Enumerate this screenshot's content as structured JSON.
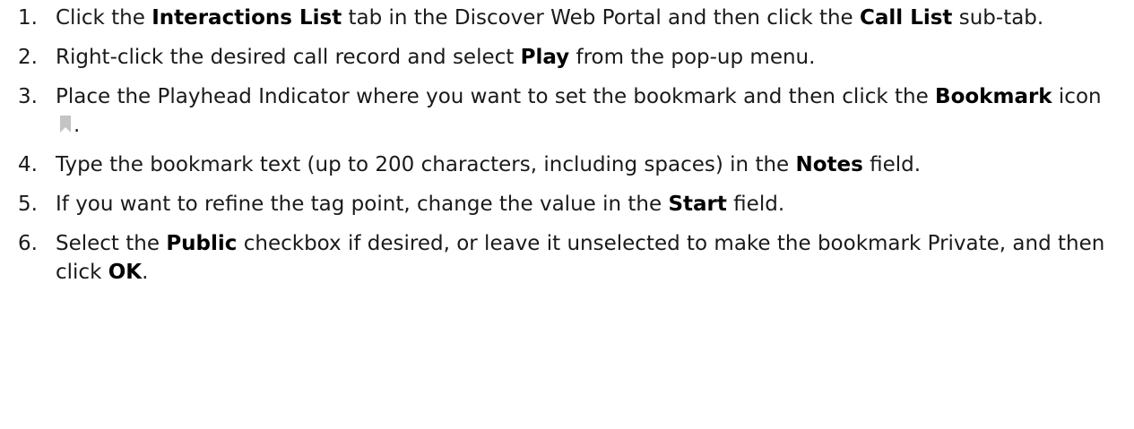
{
  "steps": [
    {
      "number": "1.",
      "parts": [
        {
          "text": "Click the ",
          "bold": false
        },
        {
          "text": "Interactions List",
          "bold": true
        },
        {
          "text": " tab in the Discover Web Portal and then click the ",
          "bold": false
        },
        {
          "text": "Call List",
          "bold": true
        },
        {
          "text": " sub-tab.",
          "bold": false
        }
      ]
    },
    {
      "number": "2.",
      "parts": [
        {
          "text": "Right-click the desired call record and select ",
          "bold": false
        },
        {
          "text": "Play",
          "bold": true
        },
        {
          "text": " from the pop-up menu.",
          "bold": false
        }
      ]
    },
    {
      "number": "3.",
      "parts": [
        {
          "text": "Place the Playhead Indicator where you want to set the bookmark and then click the ",
          "bold": false
        },
        {
          "text": "Bookmark",
          "bold": true
        },
        {
          "text": " icon ",
          "bold": false
        },
        {
          "icon": "bookmark-icon"
        },
        {
          "text": ".",
          "bold": false
        }
      ]
    },
    {
      "number": "4.",
      "parts": [
        {
          "text": "Type the bookmark text (up to 200 characters, including spaces) in the ",
          "bold": false
        },
        {
          "text": "Notes",
          "bold": true
        },
        {
          "text": " field.",
          "bold": false
        }
      ]
    },
    {
      "number": "5.",
      "parts": [
        {
          "text": "If you want to refine the tag point, change the value in the ",
          "bold": false
        },
        {
          "text": "Start",
          "bold": true
        },
        {
          "text": " field.",
          "bold": false
        }
      ]
    },
    {
      "number": "6.",
      "parts": [
        {
          "text": "Select the ",
          "bold": false
        },
        {
          "text": "Public",
          "bold": true
        },
        {
          "text": " checkbox if desired, or leave it unselected to make the bookmark Private, and then click ",
          "bold": false
        },
        {
          "text": "OK",
          "bold": true
        },
        {
          "text": ".",
          "bold": false
        }
      ]
    }
  ],
  "colors": {
    "text": "#1a1a1a",
    "bold_text": "#000000",
    "icon": "#c4c4c4",
    "background": "#ffffff"
  }
}
